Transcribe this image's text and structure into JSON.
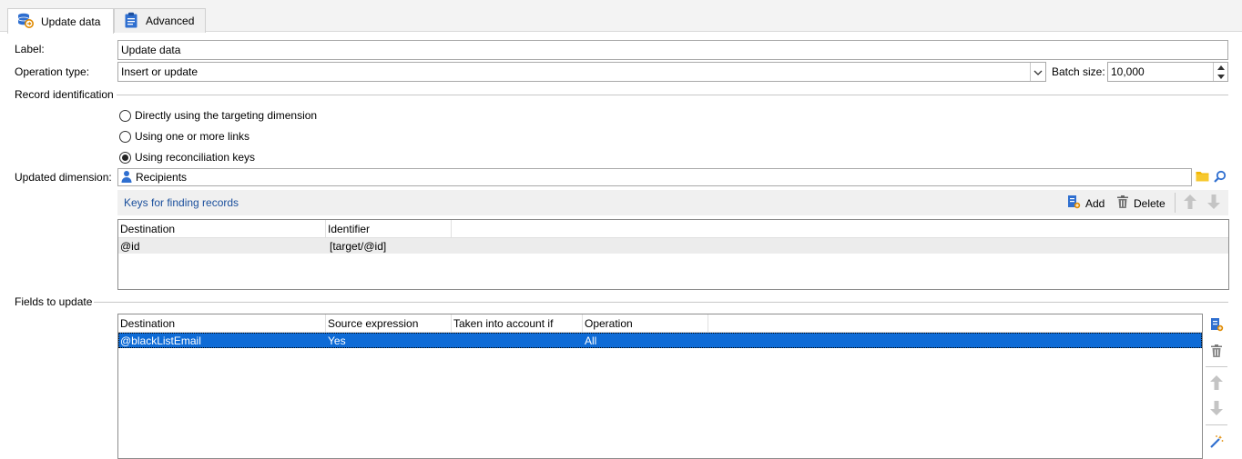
{
  "tabs": [
    {
      "label": "Update data",
      "icon": "database-update-icon",
      "active": true
    },
    {
      "label": "Advanced",
      "icon": "clipboard-icon",
      "active": false
    }
  ],
  "form": {
    "label_caption": "Label:",
    "label_value": "Update data",
    "operation_caption": "Operation type:",
    "operation_value": "Insert or update",
    "batch_caption": "Batch size:",
    "batch_value": "10,000"
  },
  "record_identification": {
    "title": "Record identification",
    "options": [
      {
        "label": "Directly using the targeting dimension",
        "checked": false
      },
      {
        "label": "Using one or more links",
        "checked": false
      },
      {
        "label": "Using reconciliation keys",
        "checked": true
      }
    ]
  },
  "dimension": {
    "caption": "Updated dimension:",
    "value": "Recipients"
  },
  "keys": {
    "title": "Keys for finding records",
    "add_label": "Add",
    "delete_label": "Delete",
    "columns": [
      "Destination",
      "Identifier"
    ],
    "rows": [
      [
        "@id",
        "[target/@id]"
      ]
    ]
  },
  "fields": {
    "title": "Fields to update",
    "columns": [
      "Destination",
      "Source expression",
      "Taken into account if",
      "Operation"
    ],
    "rows": [
      [
        "@blackListEmail",
        "Yes",
        "",
        "All"
      ]
    ]
  },
  "colors": {
    "selection": "#0e6bd6",
    "link_text": "#1a4f9c",
    "folder": "#f2b600"
  }
}
